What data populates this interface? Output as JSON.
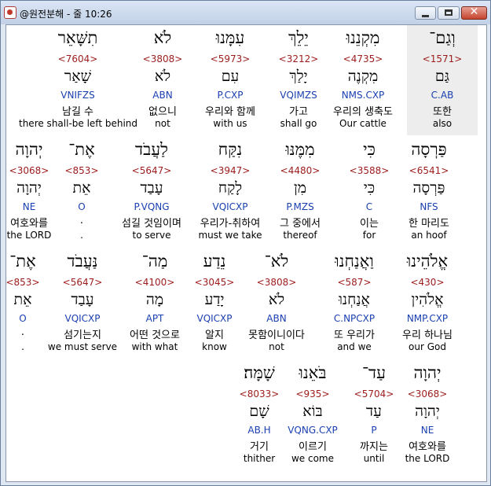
{
  "window": {
    "title": "@원전분해 - 줄 10:26"
  },
  "rows": [
    [
      {
        "heb": "וְגַם־",
        "num": "<1571>",
        "lemma": "גַּם",
        "code": "C.AB",
        "ko": "또한",
        "en": "also",
        "highlight": true
      },
      {
        "heb": "מִקְנֵנוּ",
        "num": "<4735>",
        "lemma": "מִקְנֶה",
        "code": "NMS.CXP",
        "ko": "우리의 생축도",
        "en": "Our cattle"
      },
      {
        "heb": "יֵלֵךְ",
        "num": "<3212>",
        "lemma": "יָלַךְ",
        "code": "VQIMZS",
        "ko": "가고",
        "en": "shall go"
      },
      {
        "heb": "עִמָּנוּ",
        "num": "<5973>",
        "lemma": "עִם",
        "code": "P.CXP",
        "ko": "우리와 함께",
        "en": "with us"
      },
      {
        "heb": "לֹא",
        "num": "<3808>",
        "lemma": "לֹא",
        "code": "ABN",
        "ko": "없으니",
        "en": "not"
      },
      {
        "heb": "תִשָּׁאֵר",
        "num": "<7604>",
        "lemma": "שָׁאַר",
        "code": "VNIFZS",
        "ko": "남길 수",
        "en": "there shall-be left behind"
      }
    ],
    [
      {
        "heb": "פַּרְסָה",
        "num": "<6541>",
        "lemma": "פַּרְסָה",
        "code": "NFS",
        "ko": "한 마리도",
        "en": "an hoof"
      },
      {
        "heb": "כִּי",
        "num": "<3588>",
        "lemma": "כִּי",
        "code": "C",
        "ko": "이는",
        "en": "for"
      },
      {
        "heb": "מִמֶּנּוּ",
        "num": "<4480>",
        "lemma": "מִן",
        "code": "P.MZS",
        "ko": "그 중에서",
        "en": "thereof"
      },
      {
        "heb": "נִקַּח",
        "num": "<3947>",
        "lemma": "לָקַח",
        "code": "VQICXP",
        "ko": "우리가-취하여",
        "en": "must we take"
      },
      {
        "heb": "לַעֲבֹד",
        "num": "<5647>",
        "lemma": "עָבַד",
        "code": "P.VQNG",
        "ko": "섬길 것임이며",
        "en": "to serve"
      },
      {
        "heb": "אֶת־",
        "num": "<853>",
        "lemma": "אֵת",
        "code": "O",
        "ko": ".",
        "en": "."
      },
      {
        "heb": "יְהוָה",
        "num": "<3068>",
        "lemma": "יְהוָה",
        "code": "NE",
        "ko": "여호와를",
        "en": "the LORD"
      }
    ],
    [
      {
        "heb": "אֱלֹהֵינוּ",
        "num": "<430>",
        "lemma": "אֱלֹהִין",
        "code": "NMP.CXP",
        "ko": "우리 하나님",
        "en": "our God"
      },
      {
        "heb": "וַאֲנַחְנוּ",
        "num": "<587>",
        "lemma": "אֲנַחְנוּ",
        "code": "C.NPCXP",
        "ko": "또 우리가",
        "en": "and we"
      },
      {
        "heb": "לֹא־",
        "num": "<3808>",
        "lemma": "לֹא",
        "code": "ABN",
        "ko": "못함이니이다",
        "en": "not"
      },
      {
        "heb": "נֵדַע",
        "num": "<3045>",
        "lemma": "יָדַע",
        "code": "VQICXP",
        "ko": "알지",
        "en": "know"
      },
      {
        "heb": "מַה־",
        "num": "<4100>",
        "lemma": "מָה",
        "code": "APT",
        "ko": "어떤 것으로",
        "en": "with what"
      },
      {
        "heb": "נַּעֲבֹד",
        "num": "<5647>",
        "lemma": "עָבַד",
        "code": "VQICXP",
        "ko": "섬기는지",
        "en": "we must serve"
      },
      {
        "heb": "אֶת־",
        "num": "<853>",
        "lemma": "אֵת",
        "code": "O",
        "ko": ".",
        "en": "."
      }
    ],
    [
      {
        "heb": "יְהוָה",
        "num": "<3068>",
        "lemma": "יְהוָה",
        "code": "NE",
        "ko": "여호와를",
        "en": "the LORD"
      },
      {
        "heb": "עַד־",
        "num": "<5704>",
        "lemma": "עַד",
        "code": "P",
        "ko": "까지는",
        "en": "until"
      },
      {
        "heb": "בֹּאֵנוּ",
        "num": "<935>",
        "lemma": "בּוֹא",
        "code": "VQNG.CXP",
        "ko": "이르기",
        "en": "we come"
      },
      {
        "heb": "שָׁמָּה׃",
        "num": "<8033>",
        "lemma": "שָׁם",
        "code": "AB.H",
        "ko": "거기",
        "en": "thither"
      }
    ]
  ]
}
